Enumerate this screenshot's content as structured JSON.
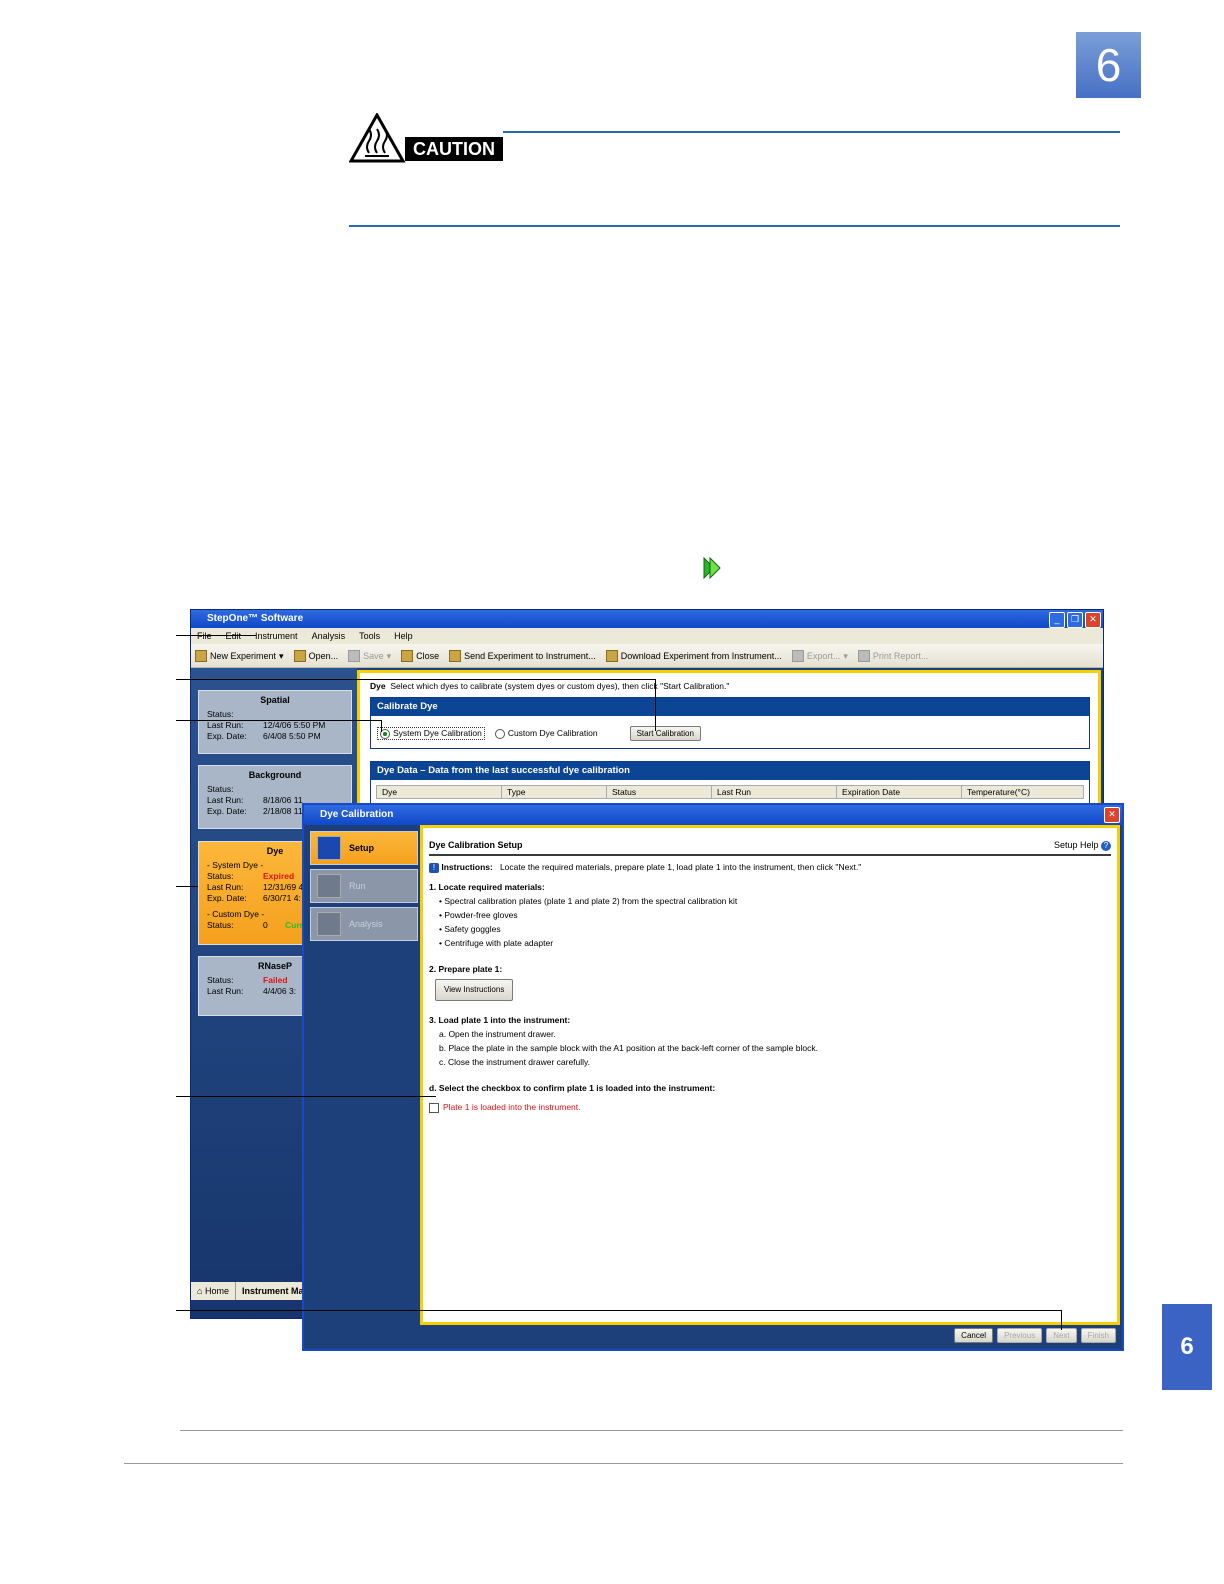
{
  "chapter_number": "6",
  "side_tab_number": "6",
  "caution": {
    "label": "CAUTION"
  },
  "window": {
    "title": "StepOne™ Software",
    "menu": [
      "File",
      "Edit",
      "Instrument",
      "Analysis",
      "Tools",
      "Help"
    ],
    "toolbar": {
      "new_experiment": "New Experiment",
      "open": "Open...",
      "save": "Save",
      "close": "Close",
      "send": "Send Experiment to Instrument...",
      "download": "Download Experiment from Instrument...",
      "export": "Export...",
      "print_report": "Print Report..."
    },
    "cards": {
      "spatial": {
        "title": "Spatial",
        "status_label": "Status:",
        "last_run_label": "Last Run:",
        "last_run": "12/4/06 5:50 PM",
        "exp_date_label": "Exp. Date:",
        "exp_date": "6/4/08 5:50 PM"
      },
      "background": {
        "title": "Background",
        "status_label": "Status:",
        "last_run_label": "Last Run:",
        "last_run": "8/18/06 11",
        "exp_date_label": "Exp. Date:",
        "exp_date": "2/18/08 11"
      },
      "dye": {
        "title": "Dye",
        "system_dye": "- System Dye -",
        "status_label": "Status:",
        "status": "Expired",
        "last_run_label": "Last Run:",
        "last_run": "12/31/69 4",
        "exp_date_label": "Exp. Date:",
        "exp_date": "6/30/71 4:",
        "custom_dye": "- Custom Dye -",
        "custom_status_label": "Status:",
        "custom_status_count": "0",
        "custom_status": "Curr"
      },
      "rnasep": {
        "title": "RNaseP",
        "status_label": "Status:",
        "status": "Failed",
        "last_run_label": "Last Run:",
        "last_run": "4/4/06 3:"
      }
    },
    "home_tabs": [
      "Home",
      "Instrument Ma"
    ],
    "instructions_label": "Dye",
    "instructions_text": "Select which dyes to calibrate (system dyes or custom dyes), then click \"Start Calibration.\"",
    "calibrate_panel": {
      "title": "Calibrate Dye",
      "system_option": "System Dye Calibration",
      "custom_option": "Custom Dye Calibration",
      "start_button": "Start Calibration"
    },
    "dye_data_panel": {
      "title": "Dye Data – Data from the last successful dye calibration",
      "columns": [
        "Dye",
        "Type",
        "Status",
        "Last Run",
        "Expiration Date",
        "Temperature(°C)"
      ]
    }
  },
  "dialog": {
    "title": "Dye Calibration",
    "steps": [
      "Setup",
      "Run",
      "Analysis"
    ],
    "heading": "Dye Calibration Setup",
    "setup_help": "Setup Help",
    "instructions_label": "Instructions:",
    "instructions_text": "Locate the required materials, prepare plate 1, load plate 1 into the instrument, then click \"Next.\"",
    "sec1_title": "1. Locate required materials:",
    "materials": [
      "Spectral calibration plates (plate 1 and plate 2) from the spectral calibration kit",
      "Powder-free gloves",
      "Safety goggles",
      "Centrifuge with plate adapter"
    ],
    "sec2_title": "2. Prepare plate 1:",
    "view_instructions": "View Instructions",
    "sec3_title": "3. Load plate 1 into the instrument:",
    "load_steps": [
      "a. Open the instrument drawer.",
      "b. Place the plate in the sample block with the A1 position at the back-left corner of the sample block.",
      "c. Close the instrument drawer carefully."
    ],
    "sec_d_title": "d. Select the checkbox to confirm plate 1 is loaded into the instrument:",
    "checkbox_label": "Plate 1 is loaded into the instrument.",
    "buttons": {
      "cancel": "Cancel",
      "previous": "Previous",
      "next": "Next",
      "finish": "Finish"
    }
  },
  "colors": {
    "accent": "#2c68b8",
    "expired": "#e01515",
    "current": "#29c12a",
    "highlight": "#f5d000"
  }
}
